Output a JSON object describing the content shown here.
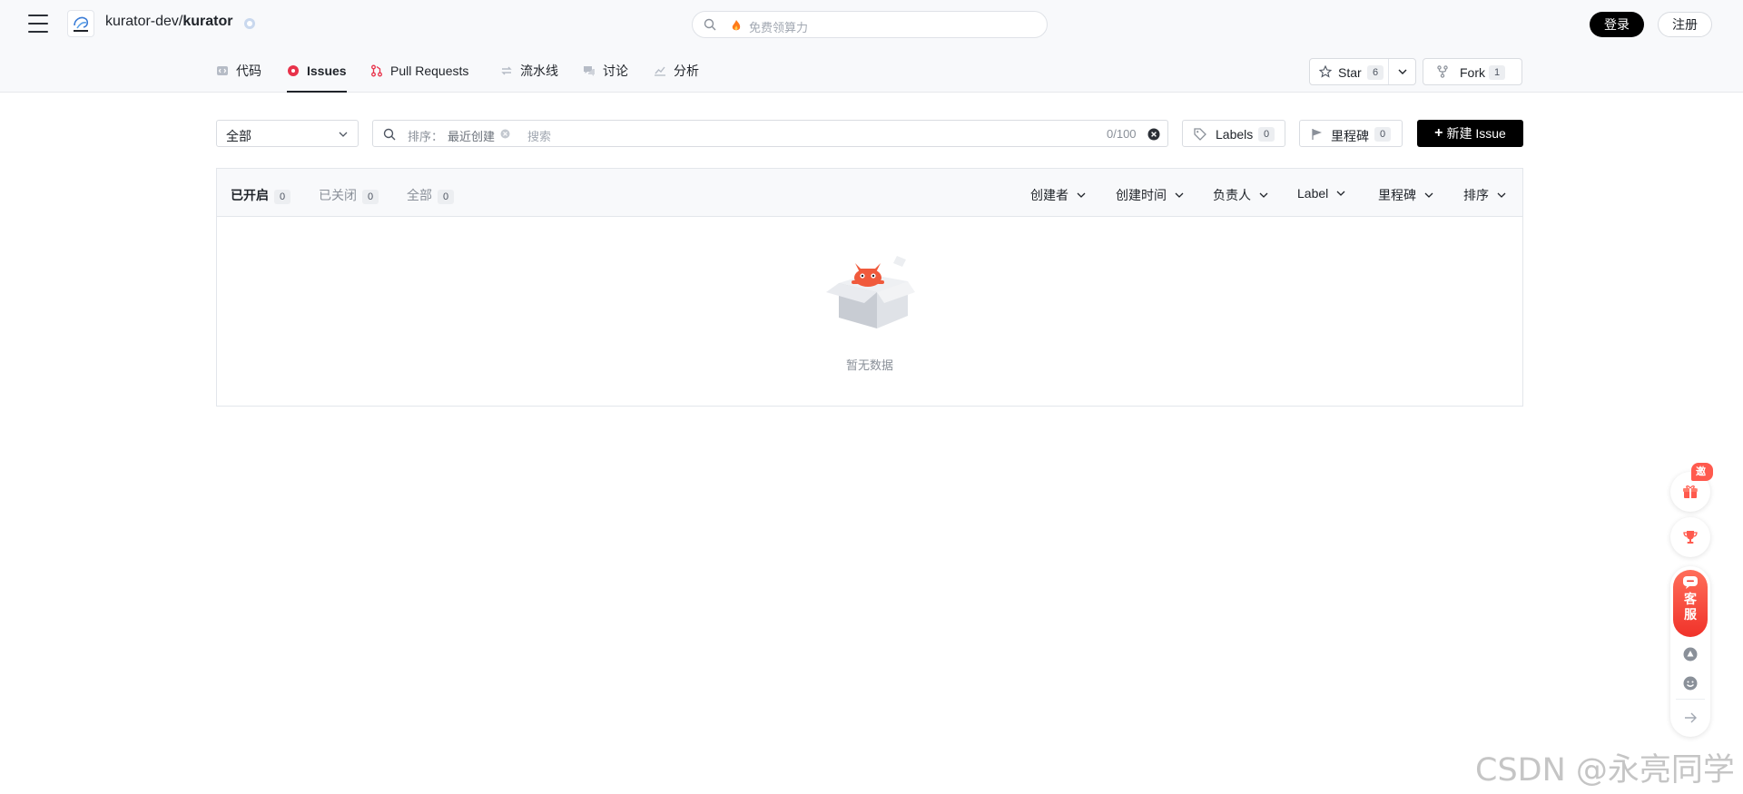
{
  "header": {
    "repo_owner": "kurator-dev/",
    "repo_name": "kurator",
    "search_placeholder": "免费领算力",
    "login_label": "登录",
    "register_label": "注册"
  },
  "repo_nav": {
    "tabs": [
      {
        "label": "代码",
        "icon": "code-icon"
      },
      {
        "label": "Issues",
        "icon": "issue-icon"
      },
      {
        "label": "Pull Requests",
        "icon": "pull-request-icon"
      },
      {
        "label": "流水线",
        "icon": "pipeline-icon"
      },
      {
        "label": "讨论",
        "icon": "discussion-icon"
      },
      {
        "label": "分析",
        "icon": "analytics-icon"
      }
    ],
    "active_tab": "Issues",
    "star": {
      "label": "Star",
      "count": "6"
    },
    "fork": {
      "label": "Fork",
      "count": "1"
    }
  },
  "toolbar": {
    "scope_value": "全部",
    "sort_label": "排序：",
    "sort_value": "最近创建",
    "search_placeholder": "搜索",
    "char_counter": "0/100",
    "labels": {
      "label": "Labels",
      "count": "0"
    },
    "milestone": {
      "label": "里程碑",
      "count": "0"
    },
    "new_issue_label": "新建 Issue"
  },
  "issues": {
    "states": [
      {
        "label": "已开启",
        "count": "0"
      },
      {
        "label": "已关闭",
        "count": "0"
      },
      {
        "label": "全部",
        "count": "0"
      }
    ],
    "filters": [
      "创建者",
      "创建时间",
      "负责人",
      "Label",
      "里程碑",
      "排序"
    ],
    "empty_text": "暂无数据"
  },
  "floating": {
    "invite_label": "邀请",
    "service_label_1": "客",
    "service_label_2": "服"
  },
  "watermark": "CSDN @永亮同学",
  "colors": {
    "accent": "#000000",
    "active_issue": "#e8324a",
    "service": "#f0322a"
  }
}
